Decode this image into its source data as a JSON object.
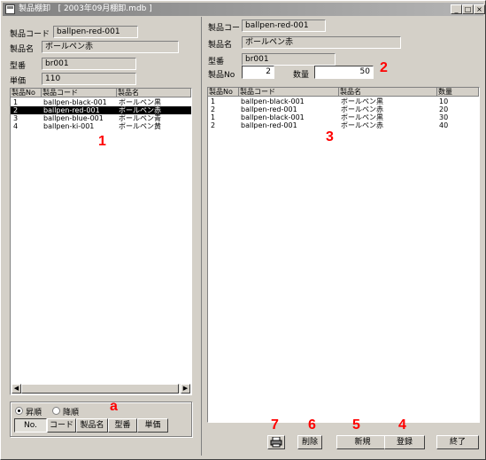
{
  "window": {
    "title": "製品棚卸   [ 2003年09月棚卸.mdb ]",
    "minimize": "_",
    "maximize": "□",
    "close": "×"
  },
  "left_panel": {
    "code_label": "製品コード",
    "code_value": "ballpen-red-001",
    "name_label": "製品名",
    "name_value": "ボールペン赤",
    "model_label": "型番",
    "model_value": "br001",
    "price_label": "単価",
    "price_value": "110",
    "list": {
      "headers": [
        "製品No",
        "製品コード",
        "製品名"
      ],
      "rows": [
        {
          "no": "1",
          "code": "ballpen-black-001",
          "name": "ボールペン黒"
        },
        {
          "no": "2",
          "code": "ballpen-red-001",
          "name": "ボールペン赤"
        },
        {
          "no": "3",
          "code": "ballpen-blue-001",
          "name": "ボールペン青"
        },
        {
          "no": "4",
          "code": "ballpen-ki-001",
          "name": "ボールペン黄"
        }
      ],
      "selected_row": 1
    },
    "sort": {
      "asc_label": "昇順",
      "desc_label": "降順",
      "selected": "asc",
      "buttons": [
        "No.",
        "コード",
        "製品名",
        "型番",
        "単価"
      ],
      "pressed": "No."
    }
  },
  "right_panel": {
    "code_label": "製品コード",
    "code_value": "ballpen-red-001",
    "name_label": "製品名",
    "name_value": "ボールペン赤",
    "model_label": "型番",
    "model_value": "br001",
    "no_label": "製品No",
    "no_value": "2",
    "qty_label": "数量",
    "qty_value": "50",
    "list": {
      "headers": [
        "製品No",
        "製品コード",
        "製品名",
        "数量"
      ],
      "rows": [
        {
          "no": "1",
          "code": "ballpen-black-001",
          "name": "ボールペン黒",
          "qty": "10"
        },
        {
          "no": "2",
          "code": "ballpen-red-001",
          "name": "ボールペン赤",
          "qty": "20"
        },
        {
          "no": "1",
          "code": "ballpen-black-001",
          "name": "ボールペン黒",
          "qty": "30"
        },
        {
          "no": "2",
          "code": "ballpen-red-001",
          "name": "ボールペン赤",
          "qty": "40"
        }
      ]
    }
  },
  "buttons": {
    "print_icon": "printer-icon",
    "delete": "削除",
    "new": "新規",
    "register": "登録",
    "exit": "終了"
  },
  "markers": {
    "m1": "1",
    "m2": "2",
    "m3": "3",
    "m4": "4",
    "m5": "5",
    "m6": "6",
    "m7": "7",
    "ma": "a"
  },
  "colors": {
    "marker": "#ff0000",
    "selection": "#000000",
    "face": "#d4d0c8"
  }
}
